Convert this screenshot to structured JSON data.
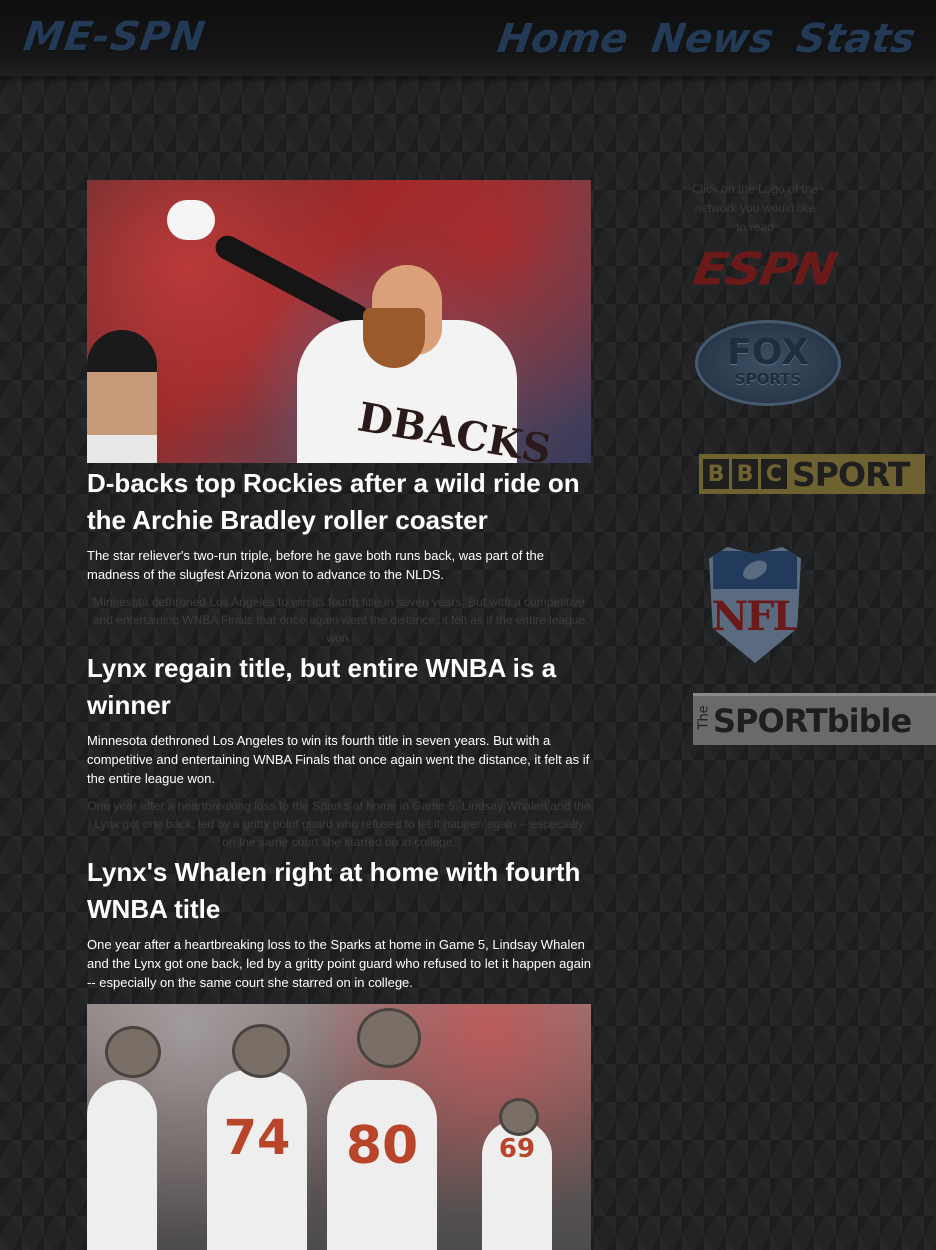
{
  "header": {
    "brand": "ME-SPN",
    "nav": [
      {
        "label": "Home"
      },
      {
        "label": "News"
      },
      {
        "label": "Stats"
      }
    ]
  },
  "articles": [
    {
      "headline": "D-backs top Rockies after a wild ride on the Archie Bradley roller coaster",
      "summary": "The star reliever's two-run triple, before he gave both runs back, was part of the madness of the slugfest Arizona won to advance to the NLDS.",
      "image_jersey_text": "DBACKS"
    },
    {
      "ghost_text": "Minnesota dethroned Los Angeles to win its fourth title in seven years. But with a competitive and entertaining WNBA Finals that once again went the distance, it felt as if the entire league won.",
      "headline": "Lynx regain title, but entire WNBA is a winner",
      "summary": "Minnesota dethroned Los Angeles to win its fourth title in seven years. But with a competitive and entertaining WNBA Finals that once again went the distance, it felt as if the entire league won."
    },
    {
      "ghost_text": "One year after a heartbreaking loss to the Sparks at home in Game 5, Lindsay Whalen and the Lynx got one back, led by a gritty point guard who refused to let it happen again -- especially on the same court she starred on in college.",
      "headline": "Lynx's Whalen right at home with fourth WNBA title",
      "summary": "One year after a heartbreaking loss to the Sparks at home in Game 5, Lindsay Whalen and the Lynx got one back, led by a gritty point guard who refused to let it happen again -- especially on the same court she starred on in college.",
      "image_numbers": [
        "74",
        "80",
        "69"
      ]
    }
  ],
  "sidebar": {
    "note": "Click on the Logo of the network you would like to read",
    "logos": {
      "espn": "ESPN",
      "fox_top": "FOX",
      "fox_bottom": "SPORTS",
      "bbc_letters": [
        "B",
        "B",
        "C"
      ],
      "bbc_sport": "SPORT",
      "nfl": "NFL",
      "sportbible_the": "The",
      "sportbible": "SPORTbible"
    }
  },
  "colors": {
    "background": "#222324",
    "brand_nav": "#223a55",
    "text": "#ffffff",
    "ghost_text": "#3d3d3d",
    "espn_logo": "#6b1a1a",
    "bbc_logo": "#6e6230"
  }
}
